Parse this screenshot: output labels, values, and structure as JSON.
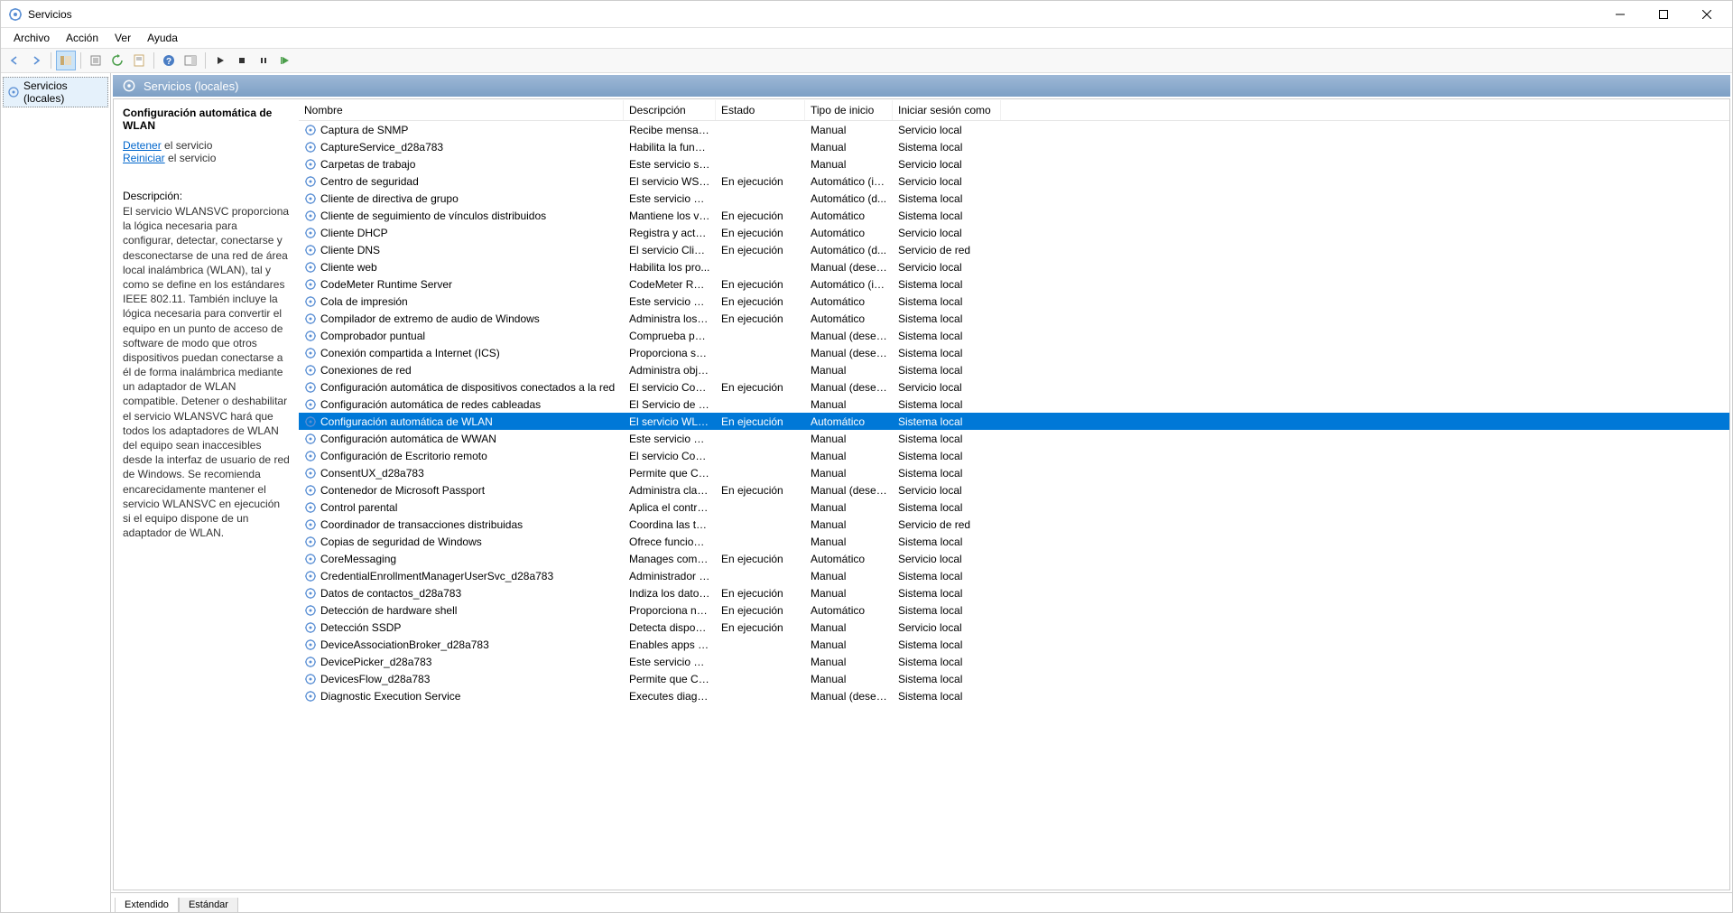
{
  "window": {
    "title": "Servicios"
  },
  "menu": {
    "items": [
      "Archivo",
      "Acción",
      "Ver",
      "Ayuda"
    ]
  },
  "tree": {
    "root": "Servicios (locales)"
  },
  "header": {
    "title": "Servicios (locales)"
  },
  "detail": {
    "title": "Configuración automática de WLAN",
    "stop_label": "Detener",
    "stop_suffix": " el servicio",
    "restart_label": "Reiniciar",
    "restart_suffix": " el servicio",
    "desc_label": "Descripción:",
    "desc": "El servicio WLANSVC proporciona la lógica necesaria para configurar, detectar, conectarse y desconectarse de una red de área local inalámbrica (WLAN), tal y como se define en los estándares IEEE 802.11. También incluye la lógica necesaria para convertir el equipo en un punto de acceso de software de modo que otros dispositivos puedan conectarse a él de forma inalámbrica mediante un adaptador de WLAN compatible. Detener o deshabilitar el servicio WLANSVC hará que todos los adaptadores de WLAN del equipo sean inaccesibles desde la interfaz de usuario de red de Windows. Se recomienda encarecidamente mantener el servicio WLANSVC en ejecución si el equipo dispone de un adaptador de WLAN."
  },
  "columns": {
    "name": "Nombre",
    "desc": "Descripción",
    "state": "Estado",
    "startup": "Tipo de inicio",
    "logon": "Iniciar sesión como"
  },
  "tabs": {
    "extended": "Extendido",
    "standard": "Estándar"
  },
  "services": [
    {
      "name": "Captura de SNMP",
      "desc": "Recibe mensaje...",
      "state": "",
      "startup": "Manual",
      "logon": "Servicio local"
    },
    {
      "name": "CaptureService_d28a783",
      "desc": "Habilita la funci...",
      "state": "",
      "startup": "Manual",
      "logon": "Sistema local"
    },
    {
      "name": "Carpetas de trabajo",
      "desc": "Este servicio sin...",
      "state": "",
      "startup": "Manual",
      "logon": "Servicio local"
    },
    {
      "name": "Centro de seguridad",
      "desc": "El servicio WSCS...",
      "state": "En ejecución",
      "startup": "Automático (in...",
      "logon": "Servicio local"
    },
    {
      "name": "Cliente de directiva de grupo",
      "desc": "Este servicio es r...",
      "state": "",
      "startup": "Automático (d...",
      "logon": "Sistema local"
    },
    {
      "name": "Cliente de seguimiento de vínculos distribuidos",
      "desc": "Mantiene los vi...",
      "state": "En ejecución",
      "startup": "Automático",
      "logon": "Sistema local"
    },
    {
      "name": "Cliente DHCP",
      "desc": "Registra y actua...",
      "state": "En ejecución",
      "startup": "Automático",
      "logon": "Servicio local"
    },
    {
      "name": "Cliente DNS",
      "desc": "El servicio Client...",
      "state": "En ejecución",
      "startup": "Automático (d...",
      "logon": "Servicio de red"
    },
    {
      "name": "Cliente web",
      "desc": "Habilita los pro...",
      "state": "",
      "startup": "Manual (desen...",
      "logon": "Servicio local"
    },
    {
      "name": "CodeMeter Runtime Server",
      "desc": "CodeMeter Run...",
      "state": "En ejecución",
      "startup": "Automático (in...",
      "logon": "Sistema local"
    },
    {
      "name": "Cola de impresión",
      "desc": "Este servicio po...",
      "state": "En ejecución",
      "startup": "Automático",
      "logon": "Sistema local"
    },
    {
      "name": "Compilador de extremo de audio de Windows",
      "desc": "Administra los d...",
      "state": "En ejecución",
      "startup": "Automático",
      "logon": "Sistema local"
    },
    {
      "name": "Comprobador puntual",
      "desc": "Comprueba pos...",
      "state": "",
      "startup": "Manual (desen...",
      "logon": "Sistema local"
    },
    {
      "name": "Conexión compartida a Internet (ICS)",
      "desc": "Proporciona ser...",
      "state": "",
      "startup": "Manual (desen...",
      "logon": "Sistema local"
    },
    {
      "name": "Conexiones de red",
      "desc": "Administra obje...",
      "state": "",
      "startup": "Manual",
      "logon": "Sistema local"
    },
    {
      "name": "Configuración automática de dispositivos conectados a la red",
      "desc": "El servicio Confi...",
      "state": "En ejecución",
      "startup": "Manual (desen...",
      "logon": "Servicio local"
    },
    {
      "name": "Configuración automática de redes cableadas",
      "desc": "El Servicio de co...",
      "state": "",
      "startup": "Manual",
      "logon": "Sistema local"
    },
    {
      "name": "Configuración automática de WLAN",
      "desc": "El servicio WLA...",
      "state": "En ejecución",
      "startup": "Automático",
      "logon": "Sistema local",
      "selected": true
    },
    {
      "name": "Configuración automática de WWAN",
      "desc": "Este servicio ad...",
      "state": "",
      "startup": "Manual",
      "logon": "Sistema local"
    },
    {
      "name": "Configuración de Escritorio remoto",
      "desc": "El servicio Confi...",
      "state": "",
      "startup": "Manual",
      "logon": "Sistema local"
    },
    {
      "name": "ConsentUX_d28a783",
      "desc": "Permite que Co...",
      "state": "",
      "startup": "Manual",
      "logon": "Sistema local"
    },
    {
      "name": "Contenedor de Microsoft Passport",
      "desc": "Administra clav...",
      "state": "En ejecución",
      "startup": "Manual (desen...",
      "logon": "Servicio local"
    },
    {
      "name": "Control parental",
      "desc": "Aplica el control...",
      "state": "",
      "startup": "Manual",
      "logon": "Sistema local"
    },
    {
      "name": "Coordinador de transacciones distribuidas",
      "desc": "Coordina las tra...",
      "state": "",
      "startup": "Manual",
      "logon": "Servicio de red"
    },
    {
      "name": "Copias de seguridad de Windows",
      "desc": "Ofrece funciona...",
      "state": "",
      "startup": "Manual",
      "logon": "Sistema local"
    },
    {
      "name": "CoreMessaging",
      "desc": "Manages comm...",
      "state": "En ejecución",
      "startup": "Automático",
      "logon": "Servicio local"
    },
    {
      "name": "CredentialEnrollmentManagerUserSvc_d28a783",
      "desc": "Administrador d...",
      "state": "",
      "startup": "Manual",
      "logon": "Sistema local"
    },
    {
      "name": "Datos de contactos_d28a783",
      "desc": "Indiza los datos ...",
      "state": "En ejecución",
      "startup": "Manual",
      "logon": "Sistema local"
    },
    {
      "name": "Detección de hardware shell",
      "desc": "Proporciona not...",
      "state": "En ejecución",
      "startup": "Automático",
      "logon": "Sistema local"
    },
    {
      "name": "Detección SSDP",
      "desc": "Detecta disposit...",
      "state": "En ejecución",
      "startup": "Manual",
      "logon": "Servicio local"
    },
    {
      "name": "DeviceAssociationBroker_d28a783",
      "desc": "Enables apps to...",
      "state": "",
      "startup": "Manual",
      "logon": "Sistema local"
    },
    {
      "name": "DevicePicker_d28a783",
      "desc": "Este servicio de ...",
      "state": "",
      "startup": "Manual",
      "logon": "Sistema local"
    },
    {
      "name": "DevicesFlow_d28a783",
      "desc": "Permite que Co...",
      "state": "",
      "startup": "Manual",
      "logon": "Sistema local"
    },
    {
      "name": "Diagnostic Execution Service",
      "desc": "Executes diagno...",
      "state": "",
      "startup": "Manual (desen...",
      "logon": "Sistema local"
    }
  ]
}
